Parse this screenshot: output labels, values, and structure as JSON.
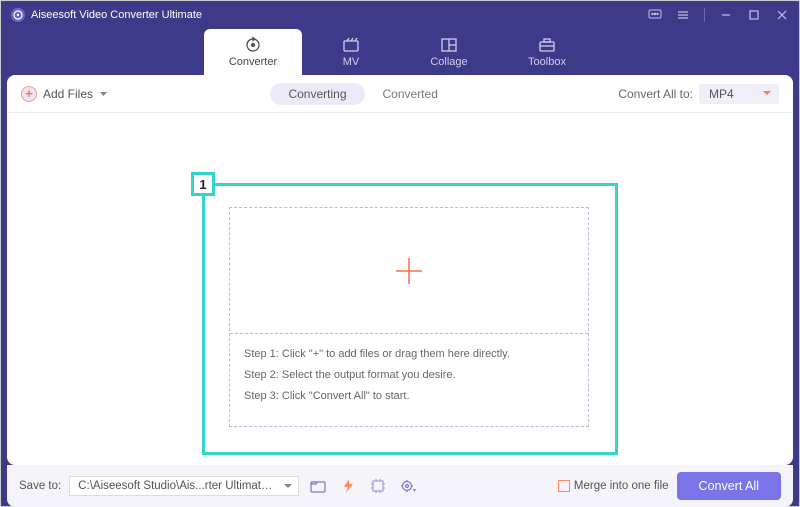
{
  "app": {
    "title": "Aiseesoft Video Converter Ultimate"
  },
  "tabs": {
    "converter": "Converter",
    "mv": "MV",
    "collage": "Collage",
    "toolbox": "Toolbox"
  },
  "subbar": {
    "add_files": "Add Files",
    "converting": "Converting",
    "converted": "Converted",
    "convert_all_to": "Convert All to:",
    "format": "MP4"
  },
  "highlight": {
    "badge": "1"
  },
  "steps": {
    "s1": "Step 1: Click \"+\" to add files or drag them here directly.",
    "s2": "Step 2: Select the output format you desire.",
    "s3": "Step 3: Click \"Convert All\" to start."
  },
  "footer": {
    "save_to": "Save to:",
    "path": "C:\\Aiseesoft Studio\\Ais...rter Ultimate\\Converted",
    "merge": "Merge into one file",
    "convert_all": "Convert All"
  }
}
